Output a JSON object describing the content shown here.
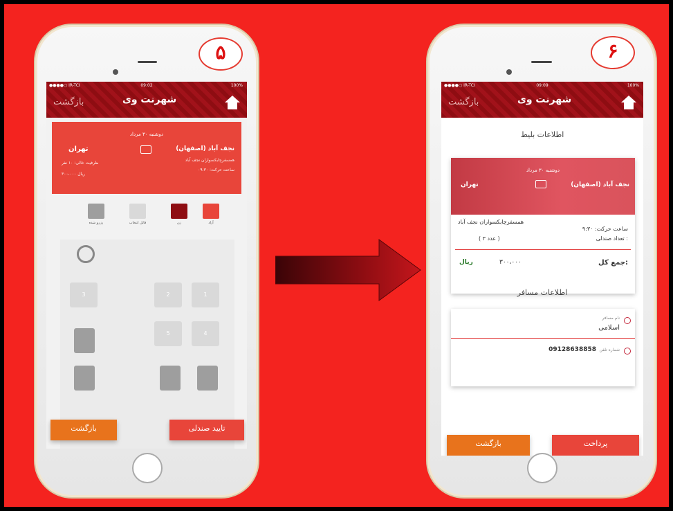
{
  "colors": {
    "accent": "#e8453a",
    "dark_red": "#8e0d12",
    "orange": "#e8731c",
    "background": "#f4231f"
  },
  "left": {
    "step": "۵",
    "status": {
      "carrier": "●●●●○ IR-TCI",
      "time": "09:02",
      "battery": "100%"
    },
    "back_label": "بازگشت",
    "logo": "شهرنت وی",
    "trip": {
      "date": "دوشنبه ۳۰ مرداد",
      "destination": "تهران",
      "origin": "نجف آباد (اصفهان)",
      "company": "همسفرچابکسواران نجف آباد",
      "time": "ساعت حرکت: ۰۹:۳۰",
      "capacity": "ظرفیت خالی: ۱۰ نفر",
      "price": "۳۰۰،۰۰۰ ریال"
    },
    "legend": [
      {
        "label": "آزاد",
        "color": "#e8453a"
      },
      {
        "label": "زن",
        "color": "#8e0d12"
      },
      {
        "label": "قابل انتخاب",
        "color": "#d9d9d9"
      },
      {
        "label": "رزرو شده",
        "color": "#9e9e9e"
      }
    ],
    "seats": {
      "numbers": [
        "1",
        "2",
        "3",
        "4",
        "5"
      ]
    },
    "confirm_label": "تایید صندلی",
    "back_button": "بازگشت"
  },
  "right": {
    "step": "۶",
    "status": {
      "carrier": "●●●●○ IR-TCI",
      "time": "09:09",
      "battery": "100%"
    },
    "back_label": "بازگشت",
    "logo": "شهرنت وی",
    "ticket_title": "اطلاعات بلیط",
    "ticket": {
      "date": "دوشنبه ۳۰ مرداد",
      "origin": "نجف آباد (اصفهان)",
      "destination": "تهران",
      "company": "همسفرچابکسواران نجف آباد",
      "departure": "ساعت حرکت: ۹:۳۰",
      "seat_count_label": "تعداد صندلی :",
      "seat_count": "( عدد ۳ )",
      "total_label": "جمع کل:",
      "total": "۳۰۰،۰۰۰",
      "currency": "ریال"
    },
    "passenger_title": "اطلاعات مسافر",
    "passenger": {
      "name_label": "نام مسافر",
      "name": "اسلامی",
      "phone_label": "شماره تلفن",
      "phone": "09128638858"
    },
    "pay_label": "پرداخت",
    "back_button": "بازگشت"
  }
}
